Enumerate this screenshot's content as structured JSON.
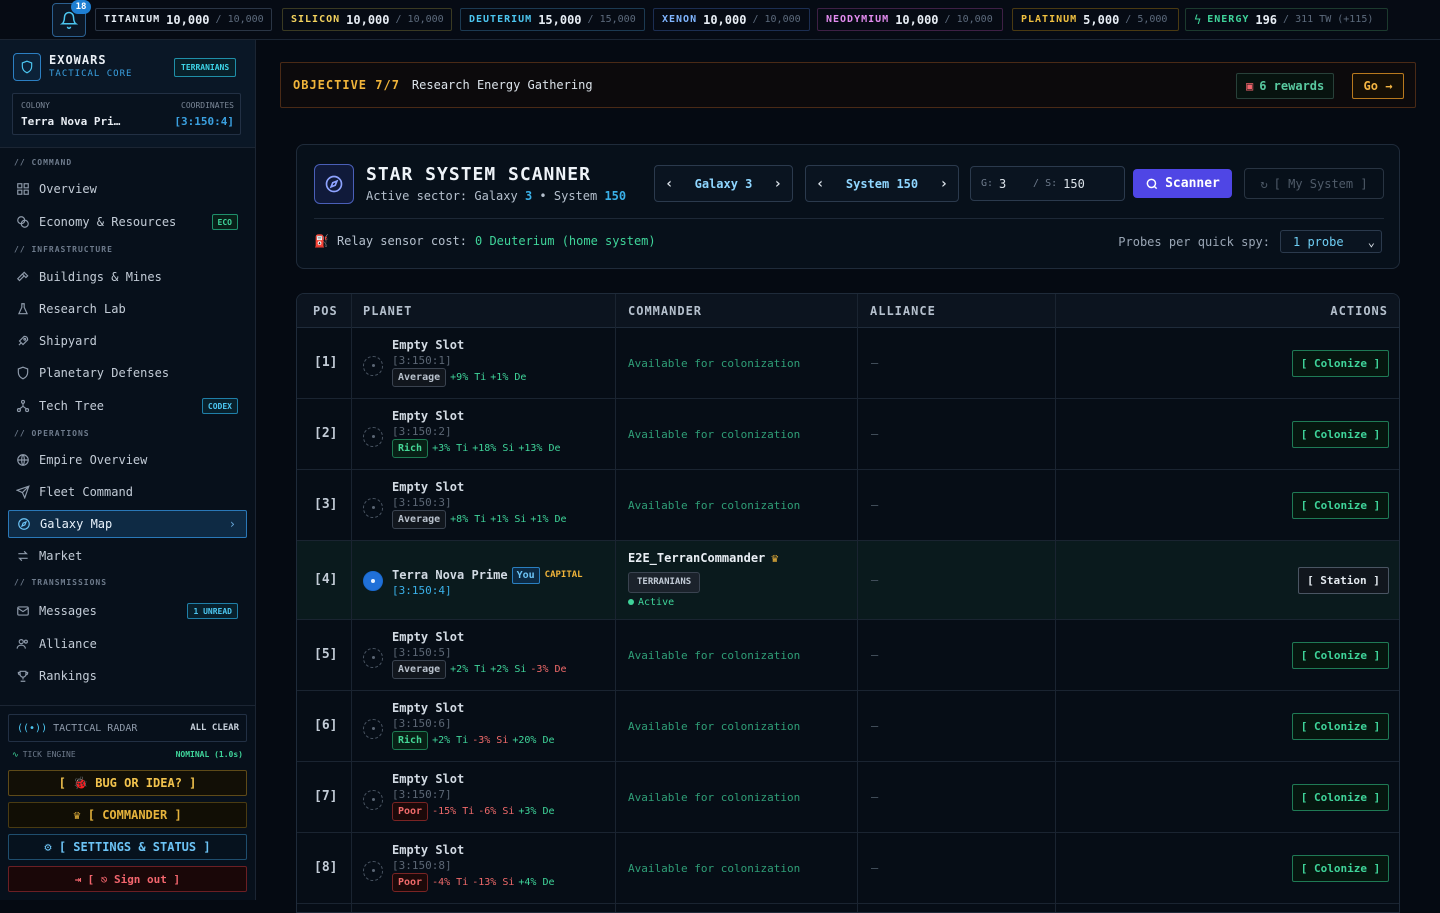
{
  "topbar": {
    "notifications": "18",
    "resources": [
      {
        "name": "TITANIUM",
        "value": "10,000",
        "cap": "/ 10,000",
        "color": "#e8eef5",
        "border": "#2a3545"
      },
      {
        "name": "SILICON",
        "value": "10,000",
        "cap": "/ 10,000",
        "color": "#f4d35e",
        "border": "#3a3a22"
      },
      {
        "name": "DEUTERIUM",
        "value": "15,000",
        "cap": "/ 15,000",
        "color": "#4cc6f0",
        "border": "#1c3a52"
      },
      {
        "name": "XENON",
        "value": "10,000",
        "cap": "/ 10,000",
        "color": "#7fb5ff",
        "border": "#1c2e52"
      },
      {
        "name": "NEODYMIUM",
        "value": "10,000",
        "cap": "/ 10,000",
        "color": "#e38cf0",
        "border": "#3e2045"
      },
      {
        "name": "PLATINUM",
        "value": "5,000",
        "cap": "/ 5,000",
        "color": "#f0c040",
        "border": "#4a3a12"
      },
      {
        "name": "ENERGY",
        "value": "196",
        "cap": "/ 311 TW (+115)",
        "color": "#3fd49a",
        "border": "#1c3a2e"
      }
    ]
  },
  "sidebar": {
    "brand_title": "EXOWARS",
    "brand_sub": "TACTICAL CORE",
    "faction": "TERRANIANS",
    "colony_label": "COLONY",
    "colony_name": "Terra Nova Pri…",
    "coords_label": "COORDINATES",
    "coords_value": "[3:150:4]",
    "sections": {
      "command": "// COMMAND",
      "infrastructure": "// INFRASTRUCTURE",
      "operations": "// OPERATIONS",
      "transmissions": "// TRANSMISSIONS"
    },
    "nav": {
      "overview": "Overview",
      "economy": "Economy & Resources",
      "economy_tag": "ECO",
      "buildings": "Buildings & Mines",
      "research": "Research Lab",
      "shipyard": "Shipyard",
      "defenses": "Planetary Defenses",
      "techtree": "Tech Tree",
      "techtree_tag": "CODEX",
      "empire": "Empire Overview",
      "fleet": "Fleet Command",
      "galaxy": "Galaxy Map",
      "market": "Market",
      "messages": "Messages",
      "messages_tag": "1 UNREAD",
      "alliance": "Alliance",
      "rankings": "Rankings"
    },
    "radar_label": "TACTICAL RADAR",
    "radar_status": "ALL CLEAR",
    "tick_label": "TICK ENGINE",
    "tick_status": "NOMINAL (1.0s)",
    "bug_button": "[ 🐞 BUG OR IDEA? ]",
    "commander_button": "♛ [ COMMANDER ]",
    "settings_button": "⚙ [ SETTINGS & STATUS ]",
    "signout_button": "[ ⎋ Sign out ]"
  },
  "objective": {
    "label": "OBJECTIVE 7/7",
    "text": "Research Energy Gathering",
    "rewards": "6 rewards",
    "go": "Go →"
  },
  "scanner": {
    "title": "STAR SYSTEM SCANNER",
    "sub_prefix": "Active sector: Galaxy",
    "galaxy": "3",
    "sub_mid": "• System",
    "system": "150",
    "galaxy_stepper": "Galaxy 3",
    "system_stepper": "System 150",
    "g_label": "G:",
    "g_value": "3",
    "s_label": "/ S:",
    "s_value": "150",
    "scan_button": "Scanner",
    "mysystem_button": "[ My System ]",
    "relay_text": "Relay sensor cost:",
    "relay_cost": "0 Deuterium (home system)",
    "probes_label": "Probes per quick spy:",
    "probes_value": "1 probe"
  },
  "table": {
    "headers": {
      "pos": "POS",
      "planet": "PLANET",
      "commander": "COMMANDER",
      "alliance": "ALLIANCE",
      "actions": "ACTIONS"
    },
    "available_text": "Available for colonization",
    "dash": "—",
    "colonize": "[ Colonize ]",
    "station": "[ Station ]",
    "rows": [
      {
        "pos": "[1]",
        "name": "Empty Slot",
        "coord": "[3:150:1]",
        "quality": "Average",
        "qclass": "",
        "bonus": [
          [
            "+9% Ti",
            "up"
          ],
          [
            "+1% De",
            "up"
          ]
        ]
      },
      {
        "pos": "[2]",
        "name": "Empty Slot",
        "coord": "[3:150:2]",
        "quality": "Rich",
        "qclass": "rich",
        "bonus": [
          [
            "+3% Ti",
            "up"
          ],
          [
            "+18% Si",
            "up"
          ],
          [
            "+13% De",
            "up"
          ]
        ]
      },
      {
        "pos": "[3]",
        "name": "Empty Slot",
        "coord": "[3:150:3]",
        "quality": "Average",
        "qclass": "",
        "bonus": [
          [
            "+8% Ti",
            "up"
          ],
          [
            "+1% Si",
            "up"
          ],
          [
            "+1% De",
            "up"
          ]
        ]
      },
      {
        "pos": "[4]",
        "own": true,
        "name": "Terra Nova Prime",
        "you": "You",
        "capital": "CAPITAL",
        "coord": "[3:150:4]",
        "commander": "E2E_TerranCommander",
        "commander_tag": "TERRANIANS",
        "status": "Active"
      },
      {
        "pos": "[5]",
        "name": "Empty Slot",
        "coord": "[3:150:5]",
        "quality": "Average",
        "qclass": "",
        "bonus": [
          [
            "+2% Ti",
            "up"
          ],
          [
            "+2% Si",
            "up"
          ],
          [
            "-3% De",
            "dn"
          ]
        ]
      },
      {
        "pos": "[6]",
        "name": "Empty Slot",
        "coord": "[3:150:6]",
        "quality": "Rich",
        "qclass": "rich",
        "bonus": [
          [
            "+2% Ti",
            "up"
          ],
          [
            "-3% Si",
            "dn"
          ],
          [
            "+20% De",
            "up"
          ]
        ]
      },
      {
        "pos": "[7]",
        "name": "Empty Slot",
        "coord": "[3:150:7]",
        "quality": "Poor",
        "qclass": "poor",
        "bonus": [
          [
            "-15% Ti",
            "dn"
          ],
          [
            "-6% Si",
            "dn"
          ],
          [
            "+3% De",
            "up"
          ]
        ]
      },
      {
        "pos": "[8]",
        "name": "Empty Slot",
        "coord": "[3:150:8]",
        "quality": "Poor",
        "qclass": "poor",
        "bonus": [
          [
            "-4% Ti",
            "dn"
          ],
          [
            "-13% Si",
            "dn"
          ],
          [
            "+4% De",
            "up"
          ]
        ]
      }
    ]
  }
}
